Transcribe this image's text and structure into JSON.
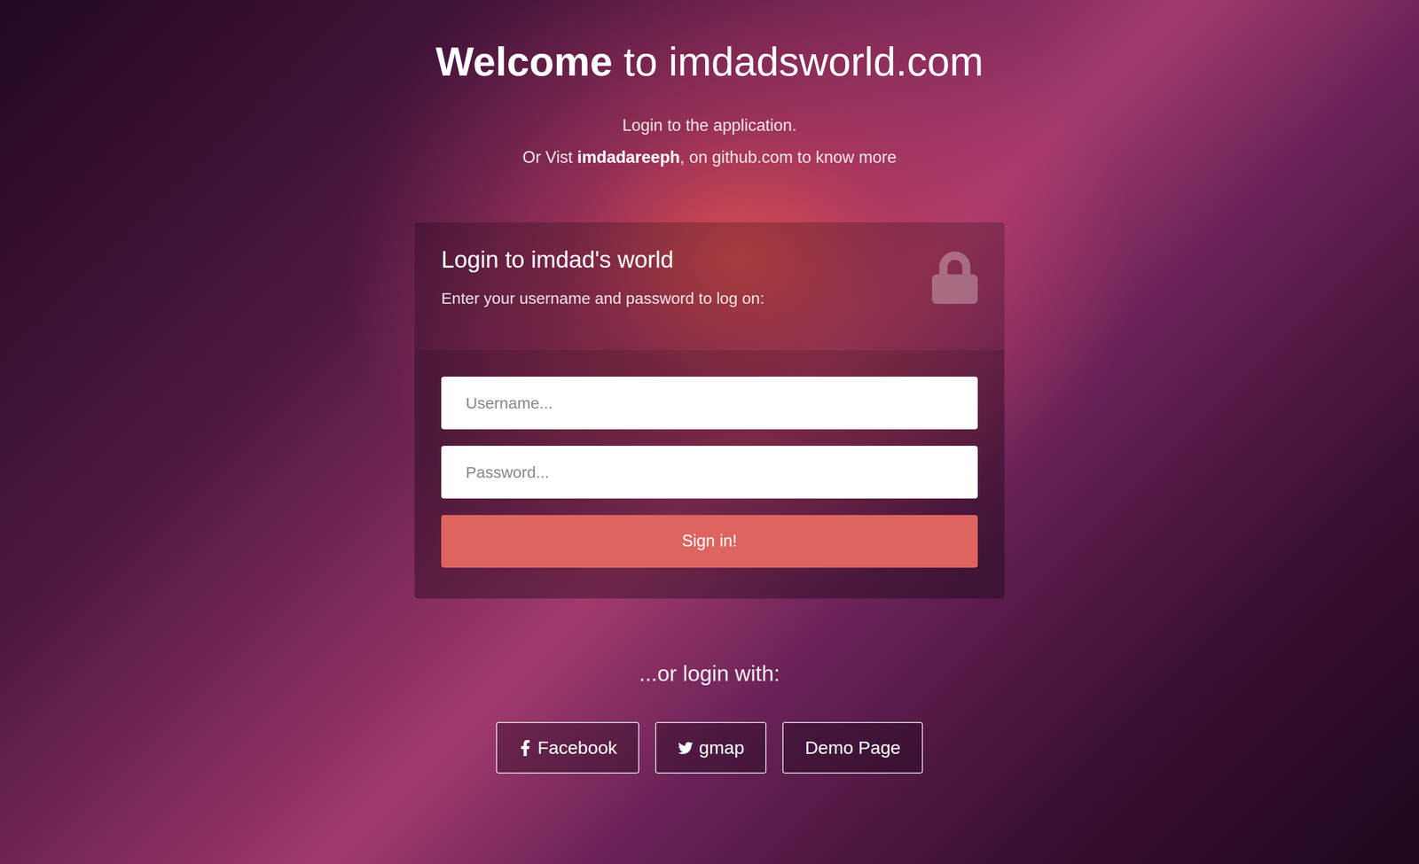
{
  "header": {
    "title": [
      {
        "text": "Welcome",
        "bold": true
      },
      {
        "text": " to imdadsworld.com",
        "bold": false
      }
    ],
    "lines": [
      [
        {
          "text": "Login to the application.",
          "bold": false
        }
      ],
      [
        {
          "text": "Or Vist ",
          "bold": false
        },
        {
          "text": "imdadareeph",
          "bold": true
        },
        {
          "text": ", on github.com to know more",
          "bold": false
        }
      ]
    ]
  },
  "login_form": {
    "title": "Login to imdad's world",
    "description": "Enter your username and password to log on:",
    "fields": [
      {
        "placeholder": "Username...",
        "kind": "text"
      },
      {
        "placeholder": "Password...",
        "kind": "password"
      }
    ],
    "submit": "Sign in!"
  },
  "social": {
    "label": "...or login with:",
    "buttons": [
      {
        "label": "Facebook",
        "kind": "facebook"
      },
      {
        "label": "gmap",
        "kind": "twitter"
      },
      {
        "label": "Demo Page",
        "kind": "plain"
      }
    ]
  }
}
